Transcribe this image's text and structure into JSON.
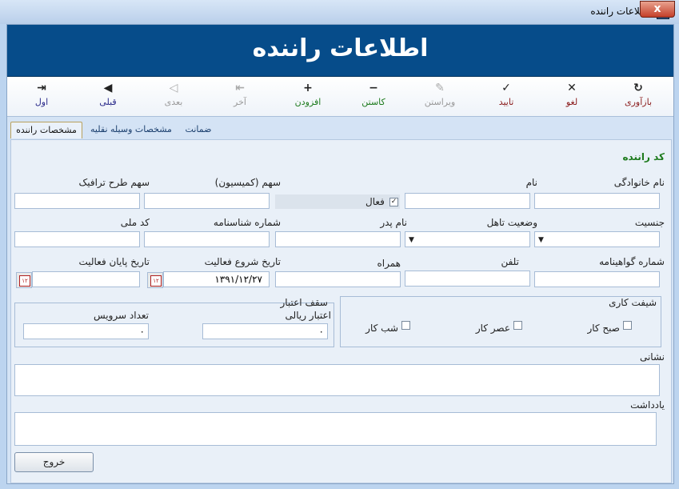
{
  "window": {
    "title": "اطلاعات راننده",
    "close_symbol": "x"
  },
  "banner": {
    "title": "اطلاعات راننده"
  },
  "toolbar": {
    "buttons": [
      {
        "label": "بازآوری",
        "icon": "refresh-icon",
        "glyph": "↻",
        "color": "#8a1b1b"
      },
      {
        "label": "لغو",
        "icon": "cancel-x-icon",
        "glyph": "✕",
        "color": "#8a1b1b"
      },
      {
        "label": "تایید",
        "icon": "checkmark-icon",
        "glyph": "✓",
        "color": "#8a1b1b"
      },
      {
        "label": "ویراستن",
        "icon": "pencil-icon",
        "glyph": "✎",
        "color": "#9a9a9a"
      },
      {
        "label": "کاستن",
        "icon": "minus-icon",
        "glyph": "−",
        "color": "#1c7a1c"
      },
      {
        "label": "افزودن",
        "icon": "plus-icon",
        "glyph": "+",
        "color": "#1c7a1c"
      },
      {
        "label": "آخر",
        "icon": "last-icon",
        "glyph": "⇤",
        "color": "#9a9a9a"
      },
      {
        "label": "بعدی",
        "icon": "next-icon",
        "glyph": "◁",
        "color": "#9a9a9a"
      },
      {
        "label": "قبلی",
        "icon": "previous-icon",
        "glyph": "◀",
        "color": "#2a2a8a"
      },
      {
        "label": "اول",
        "icon": "first-icon",
        "glyph": "⇥",
        "color": "#2a2a8a"
      }
    ]
  },
  "tabs": [
    "مشخصات راننده",
    "مشخصات وسیله نقلیه",
    "ضمانت"
  ],
  "form": {
    "section_title": "کد راننده",
    "last_name": "نام خانوادگی",
    "first_name": "نام",
    "active": "فعال",
    "active_checked": "✓",
    "commission_share": "سهم (کمیسیون)",
    "traffic_plan_share": "سهم طرح ترافیک",
    "gender": "جنسیت",
    "marital_status": "وضعیت تاهل",
    "father_name": "نام پدر",
    "id_number": "شماره شناسنامه",
    "national_code": "کد ملی",
    "license_number": "شماره گواهینامه",
    "phone": "تلفن",
    "mobile": "همراه",
    "start_date": "تاریخ شروع فعالیت",
    "start_date_value": "۱۳۹۱/۱۲/۲۷",
    "end_date": "تاریخ پایان فعالیت",
    "work_shift": "شیفت کاری",
    "morning": "صبح کار",
    "afternoon": "عصر کار",
    "night": "شب کار",
    "credit_cap": "سقف اعتبار",
    "rial_credit": "اعتبار ریالی",
    "rial_credit_value": "۰",
    "service_count": "تعداد سرویس",
    "service_count_value": "۰",
    "address": "نشانی",
    "notes": "یادداشت",
    "calendar_glyph": "۱۲"
  },
  "footer": {
    "exit": "خروج"
  },
  "colors": {
    "banner": "#064c8a",
    "window": "#bcd4ef"
  }
}
